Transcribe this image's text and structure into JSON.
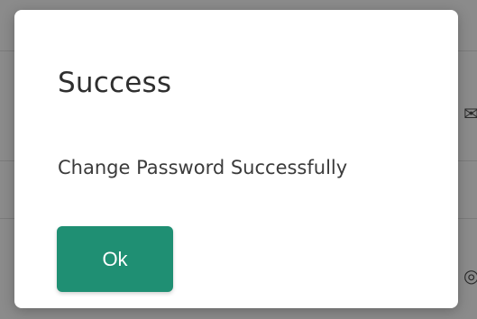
{
  "dialog": {
    "title": "Success",
    "message": "Change Password Successfully",
    "ok_label": "Ok"
  },
  "icons": {
    "mail": "mail-icon",
    "target": "target-icon"
  },
  "colors": {
    "overlay": "#8c8c8c",
    "dialog_background": "#ffffff",
    "button": "#1f8f73",
    "text": "#2f2f2f"
  }
}
